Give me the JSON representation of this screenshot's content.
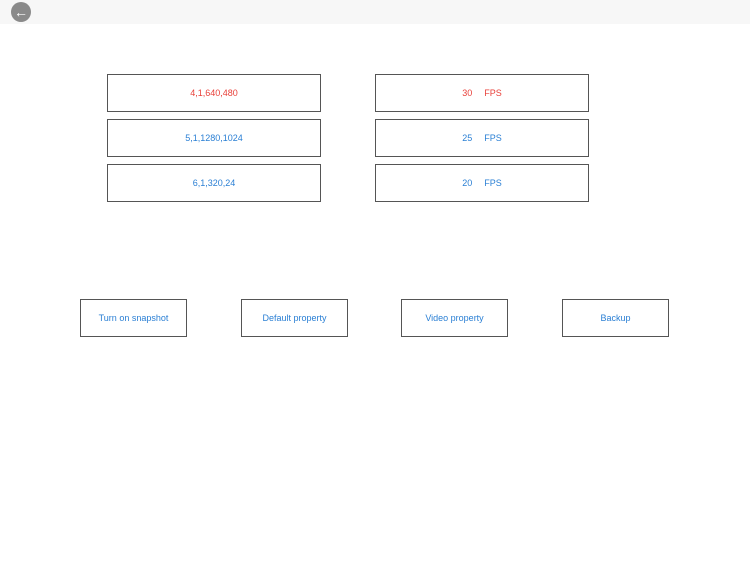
{
  "header": {
    "back_icon": "back-arrow-icon"
  },
  "colors": {
    "selected": "#e8403a",
    "normal": "#2a7fd4"
  },
  "resolutions": [
    {
      "label": "4,1,640,480",
      "selected": true
    },
    {
      "label": "5,1,1280,1024",
      "selected": false
    },
    {
      "label": "6,1,320,24",
      "selected": false
    }
  ],
  "framerates": [
    {
      "value": "30",
      "unit": "FPS",
      "selected": true
    },
    {
      "value": "25",
      "unit": "FPS",
      "selected": false
    },
    {
      "value": "20",
      "unit": "FPS",
      "selected": false
    }
  ],
  "actions": {
    "snapshot": "Turn on snapshot",
    "default": "Default property",
    "video": "Video property",
    "backup": "Backup"
  }
}
